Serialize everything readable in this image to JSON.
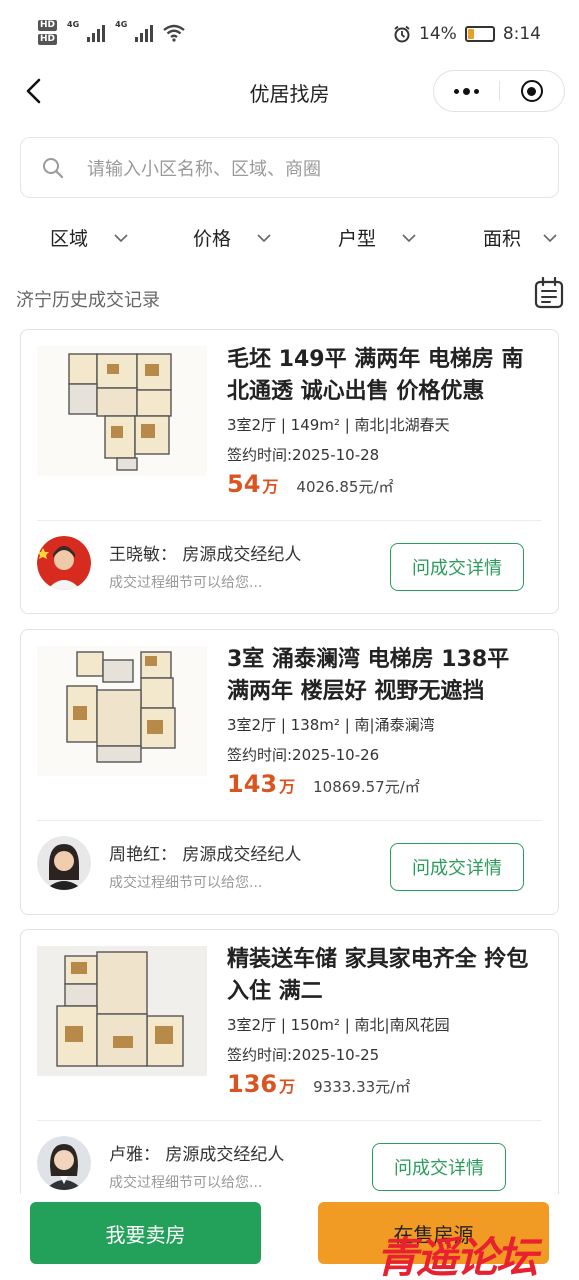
{
  "status_bar": {
    "hd1": "HD",
    "hd2": "HD",
    "net1": "4G",
    "net2": "4G",
    "battery": "14%",
    "time": "8:14"
  },
  "nav": {
    "title": "优居找房"
  },
  "search": {
    "placeholder": "请输入小区名称、区域、商圈"
  },
  "filters": [
    "区域",
    "价格",
    "户型",
    "面积"
  ],
  "section_title": "济宁历史成交记录",
  "listings": [
    {
      "title": "毛坯 149平 满两年 电梯房 南北通透 诚心出售 价格优惠",
      "spec": "3室2厅 | 149m² | 南北|北湖春天",
      "date": "签约时间:2025-10-28",
      "price": "54",
      "unit": "万",
      "unit_price": "4026.85元/㎡",
      "agent": "王晓敏： 房源成交经纪人",
      "note": "成交过程细节可以给您...",
      "button": "问成交详情"
    },
    {
      "title": "3室 涌泰澜湾 电梯房 138平 满两年 楼层好 视野无遮挡",
      "spec": "3室2厅 | 138m² | 南|涌泰澜湾",
      "date": "签约时间:2025-10-26",
      "price": "143",
      "unit": "万",
      "unit_price": "10869.57元/㎡",
      "agent": "周艳红： 房源成交经纪人",
      "note": "成交过程细节可以给您...",
      "button": "问成交详情"
    },
    {
      "title": "精装送车储 家具家电齐全 拎包入住 满二",
      "spec": "3室2厅 | 150m² | 南北|南风花园",
      "date": "签约时间:2025-10-25",
      "price": "136",
      "unit": "万",
      "unit_price": "9333.33元/㎡",
      "agent": "卢雅： 房源成交经纪人",
      "note": "成交过程细节可以给您...",
      "button": "问成交详情"
    }
  ],
  "bottom": {
    "sell": "我要卖房",
    "on_sale": "在售房源"
  },
  "watermark": "青遥论坛",
  "colors": {
    "accent_green": "#23a05a",
    "price_orange": "#d9541e",
    "onsale_orange": "#f29b24"
  }
}
